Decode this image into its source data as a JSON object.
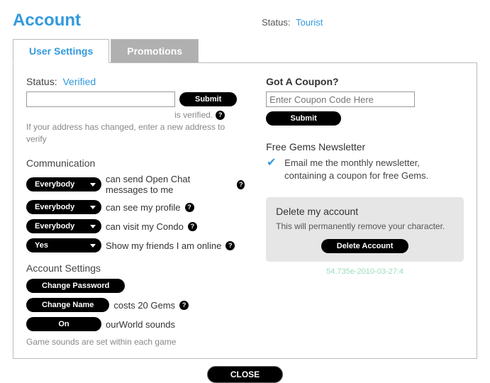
{
  "header": {
    "title": "Account",
    "status_label": "Status:",
    "status_value": "Tourist"
  },
  "tabs": {
    "user_settings": "User Settings",
    "promotions": "Promotions"
  },
  "verify": {
    "status_label": "Status:",
    "status_value": "Verified",
    "submit": "Submit",
    "verified_hint": "is verified.",
    "changed_hint": "If your address has changed, enter a new address to verify"
  },
  "communication": {
    "heading": "Communication",
    "rows": [
      {
        "select": "Everybody",
        "text": "can send Open Chat messages to me"
      },
      {
        "select": "Everybody",
        "text": "can see my profile"
      },
      {
        "select": "Everybody",
        "text": "can visit my Condo"
      },
      {
        "select": "Yes",
        "text": "Show my friends I am online"
      }
    ]
  },
  "account_settings": {
    "heading": "Account Settings",
    "change_password": "Change Password",
    "change_name": "Change Name",
    "change_name_cost": "costs 20 Gems",
    "sounds_toggle": "On",
    "sounds_text": "ourWorld sounds",
    "sounds_hint": "Game sounds are set within each game"
  },
  "coupon": {
    "heading": "Got A Coupon?",
    "placeholder": "Enter Coupon Code Here",
    "submit": "Submit"
  },
  "newsletter": {
    "heading": "Free Gems Newsletter",
    "text": "Email me the monthly newsletter, containing a coupon for free Gems."
  },
  "delete": {
    "heading": "Delete my account",
    "text": "This will permanently remove your character.",
    "button": "Delete Account"
  },
  "version": "54.735e-2010-03-27:4",
  "close": "CLOSE",
  "help_char": "?"
}
